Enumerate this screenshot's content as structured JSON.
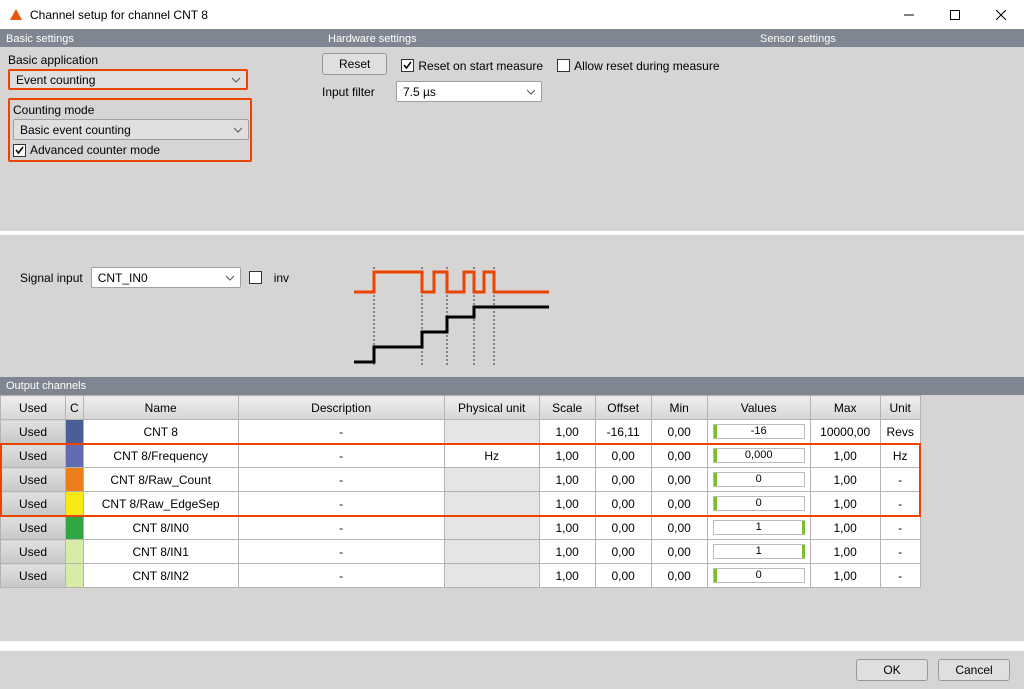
{
  "window": {
    "title": "Channel setup for channel CNT 8"
  },
  "sections": {
    "basic": "Basic settings",
    "hardware": "Hardware settings",
    "sensor": "Sensor settings"
  },
  "basic": {
    "app_label": "Basic application",
    "app_value": "Event counting",
    "count_label": "Counting mode",
    "count_value": "Basic event counting",
    "adv_label": "Advanced counter mode",
    "adv_checked": true
  },
  "hardware": {
    "reset_btn": "Reset",
    "reset_on_start": {
      "label": "Reset on start measure",
      "checked": true
    },
    "allow_reset": {
      "label": "Allow reset during measure",
      "checked": false
    },
    "filter_label": "Input filter",
    "filter_value": "7.5 µs"
  },
  "signal": {
    "label": "Signal input",
    "value": "CNT_IN0",
    "inv_label": "inv",
    "inv_checked": false
  },
  "output": {
    "header": "Output channels",
    "cols": {
      "used": "Used",
      "c": "C",
      "name": "Name",
      "desc": "Description",
      "phys": "Physical unit",
      "scale": "Scale",
      "offset": "Offset",
      "min": "Min",
      "values": "Values",
      "max": "Max",
      "unit": "Unit"
    },
    "rows": [
      {
        "used": "Used",
        "color": "#4b5e98",
        "name": "CNT 8",
        "desc": "-",
        "phys": "",
        "phys_shaded": true,
        "scale": "1,00",
        "offset": "-16,11",
        "min": "0,00",
        "value": "-16",
        "tick_pos": 0,
        "max": "10000,00",
        "unit": "Revs"
      },
      {
        "used": "Used",
        "color": "#636bb0",
        "name": "CNT 8/Frequency",
        "desc": "-",
        "phys": "Hz",
        "phys_shaded": false,
        "scale": "1,00",
        "offset": "0,00",
        "min": "0,00",
        "value": "0,000",
        "tick_pos": 0,
        "max": "1,00",
        "unit": "Hz"
      },
      {
        "used": "Used",
        "color": "#ea7e19",
        "name": "CNT 8/Raw_Count",
        "desc": "-",
        "phys": "",
        "phys_shaded": true,
        "scale": "1,00",
        "offset": "0,00",
        "min": "0,00",
        "value": "0",
        "tick_pos": 0,
        "max": "1,00",
        "unit": "-"
      },
      {
        "used": "Used",
        "color": "#f7ea14",
        "name": "CNT 8/Raw_EdgeSep",
        "desc": "-",
        "phys": "",
        "phys_shaded": true,
        "scale": "1,00",
        "offset": "0,00",
        "min": "0,00",
        "value": "0",
        "tick_pos": 0,
        "max": "1,00",
        "unit": "-"
      },
      {
        "used": "Used",
        "color": "#2fa743",
        "name": "CNT 8/IN0",
        "desc": "-",
        "phys": "",
        "phys_shaded": true,
        "scale": "1,00",
        "offset": "0,00",
        "min": "0,00",
        "value": "1",
        "tick_pos": 88,
        "max": "1,00",
        "unit": "-"
      },
      {
        "used": "Used",
        "color": "#d7eca6",
        "name": "CNT 8/IN1",
        "desc": "-",
        "phys": "",
        "phys_shaded": true,
        "scale": "1,00",
        "offset": "0,00",
        "min": "0,00",
        "value": "1",
        "tick_pos": 88,
        "max": "1,00",
        "unit": "-"
      },
      {
        "used": "Used",
        "color": "#d7eca6",
        "name": "CNT 8/IN2",
        "desc": "-",
        "phys": "",
        "phys_shaded": true,
        "scale": "1,00",
        "offset": "0,00",
        "min": "0,00",
        "value": "0",
        "tick_pos": 0,
        "max": "1,00",
        "unit": "-"
      }
    ]
  },
  "footer": {
    "ok": "OK",
    "cancel": "Cancel"
  }
}
